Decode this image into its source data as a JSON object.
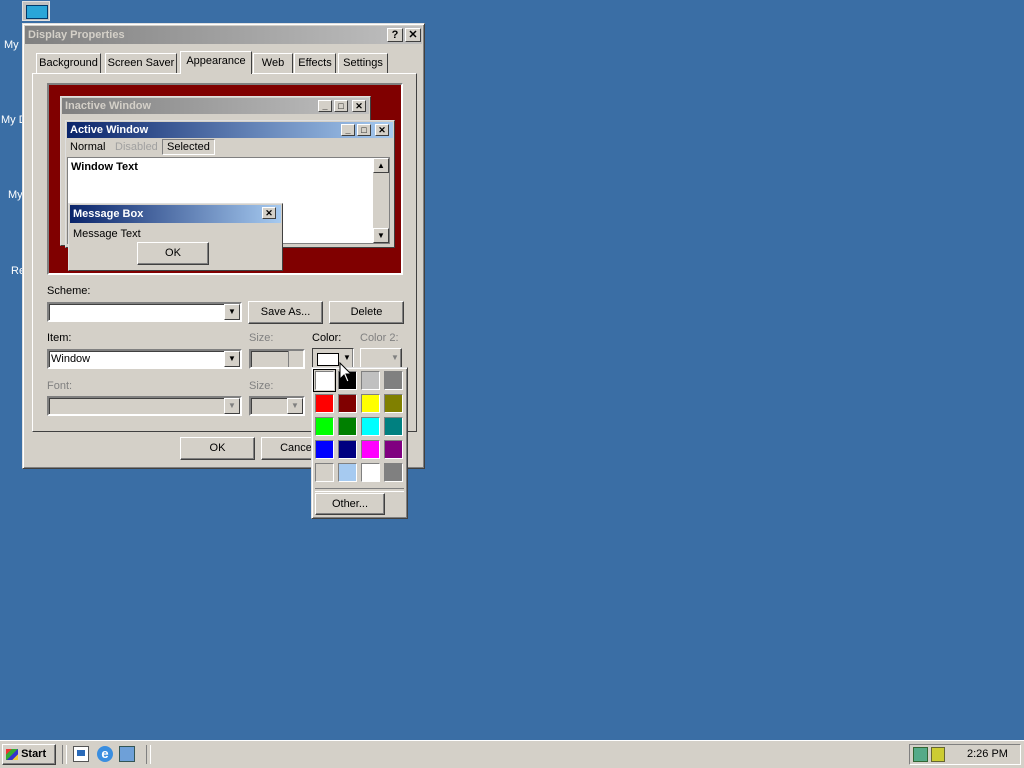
{
  "desktop": {
    "icon_labels": [
      "My",
      "My D",
      "My",
      "Re"
    ]
  },
  "window": {
    "title": "Display Properties",
    "help_glyph": "?",
    "close_glyph": "✕",
    "tabs": [
      "Background",
      "Screen Saver",
      "Appearance",
      "Web",
      "Effects",
      "Settings"
    ],
    "active_tab": "Appearance"
  },
  "preview": {
    "inactive_title": "Inactive Window",
    "active_title": "Active Window",
    "menu": [
      "Normal",
      "Disabled",
      "Selected"
    ],
    "window_text": "Window Text",
    "message_title": "Message Box",
    "message_text": "Message Text",
    "ok_label": "OK",
    "colors": {
      "desktop": "#800000",
      "active_title_start": "#0a246a",
      "active_title_end": "#a6caf0",
      "inactive_title_start": "#808080",
      "inactive_title_end": "#c0c0c0"
    }
  },
  "controls": {
    "scheme_label": "Scheme:",
    "scheme_value": "",
    "save_as_label": "Save As...",
    "delete_label": "Delete",
    "item_label": "Item:",
    "item_value": "Window",
    "size_label": "Size:",
    "color_label": "Color:",
    "color2_label": "Color 2:",
    "font_label": "Font:",
    "font_size_label": "Size:",
    "selected_color": "#ffffff"
  },
  "palette": {
    "colors": [
      "#ffffff",
      "#000000",
      "#c0c0c0",
      "#808080",
      "#ff0000",
      "#800000",
      "#ffff00",
      "#808000",
      "#00ff00",
      "#008000",
      "#00ffff",
      "#008080",
      "#0000ff",
      "#000080",
      "#ff00ff",
      "#800080",
      "#d4d0c8",
      "#a6caf0",
      "#ffffff",
      "#808080"
    ],
    "selected_index": 0,
    "other_label": "Other..."
  },
  "footer": {
    "ok_label": "OK",
    "cancel_label": "Cance"
  },
  "taskbar": {
    "start_label": "Start",
    "clock": "2:26 PM"
  }
}
